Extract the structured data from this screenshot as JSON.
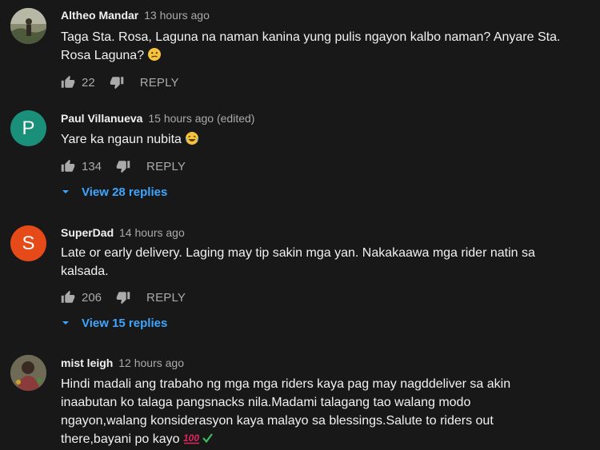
{
  "comments": [
    {
      "author": "Altheo Mandar",
      "meta": "13 hours ago",
      "text": "Taga Sta. Rosa, Laguna na naman kanina yung pulis ngayon kalbo naman? Anyare Sta. Rosa Laguna?",
      "emoji": "confused-face-icon",
      "likes": "22",
      "reply_label": "REPLY"
    },
    {
      "author": "Paul Villanueva",
      "meta": "15 hours ago (edited)",
      "avatar_letter": "P",
      "avatar_color": "#1a8f7a",
      "text": "Yare ka ngaun nubita",
      "emoji": "laughing-face-icon",
      "likes": "134",
      "reply_label": "REPLY",
      "view_replies": "View 28 replies"
    },
    {
      "author": "SuperDad",
      "meta": "14 hours ago",
      "avatar_letter": "S",
      "avatar_color": "#e64a19",
      "text": "Late or early delivery. Laging may tip sakin mga yan. Nakakaawa mga rider natin sa kalsada.",
      "likes": "206",
      "reply_label": "REPLY",
      "view_replies": "View 15 replies"
    },
    {
      "author": "mist leigh",
      "meta": "12 hours ago",
      "text": "Hindi madali ang trabaho ng mga mga riders kaya pag may nagddeliver sa akin inaabutan ko talaga pangsnacks nila.Madami talagang tao walang modo ngayon,walang konsiderasyon kaya malayo sa blessings.Salute to riders out there,bayani po kayo",
      "emoji": "hundred-points-and-check-icon"
    }
  ],
  "colors": {
    "background": "#181818",
    "link": "#3ea6ff",
    "secondary_text": "#aaaaaa"
  }
}
